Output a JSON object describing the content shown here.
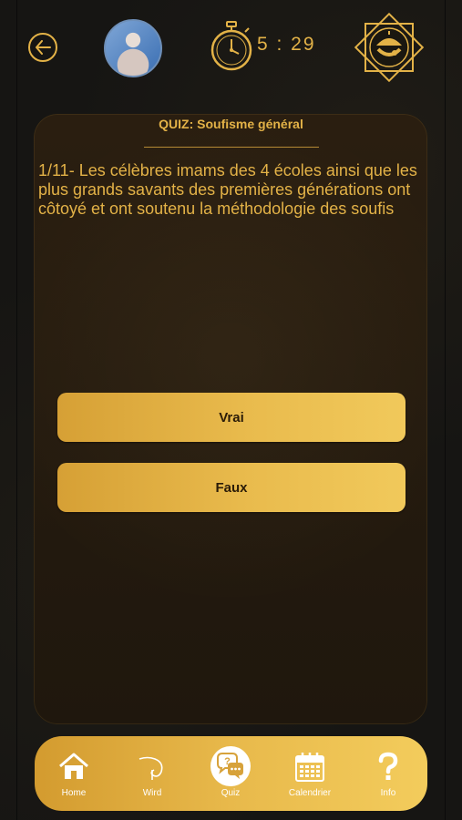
{
  "header": {
    "timer": "5 : 29"
  },
  "quiz": {
    "title": "QUIZ: Soufisme général",
    "question": "1/11- Les célèbres imams des 4 écoles ainsi que les plus grands savants des premières générations ont côtoyé et ont soutenu la méthodologie des soufis",
    "answers": [
      "Vrai",
      "Faux"
    ]
  },
  "nav": {
    "items": [
      {
        "label": "Home",
        "icon": "home-icon"
      },
      {
        "label": "Wird",
        "icon": "wird-icon"
      },
      {
        "label": "Quiz",
        "icon": "quiz-chat-icon"
      },
      {
        "label": "Calendrier",
        "icon": "calendar-icon"
      },
      {
        "label": "Info",
        "icon": "question-icon"
      }
    ]
  },
  "colors": {
    "accent": "#e3b247",
    "background": "#161513",
    "card": "#251b0e"
  }
}
